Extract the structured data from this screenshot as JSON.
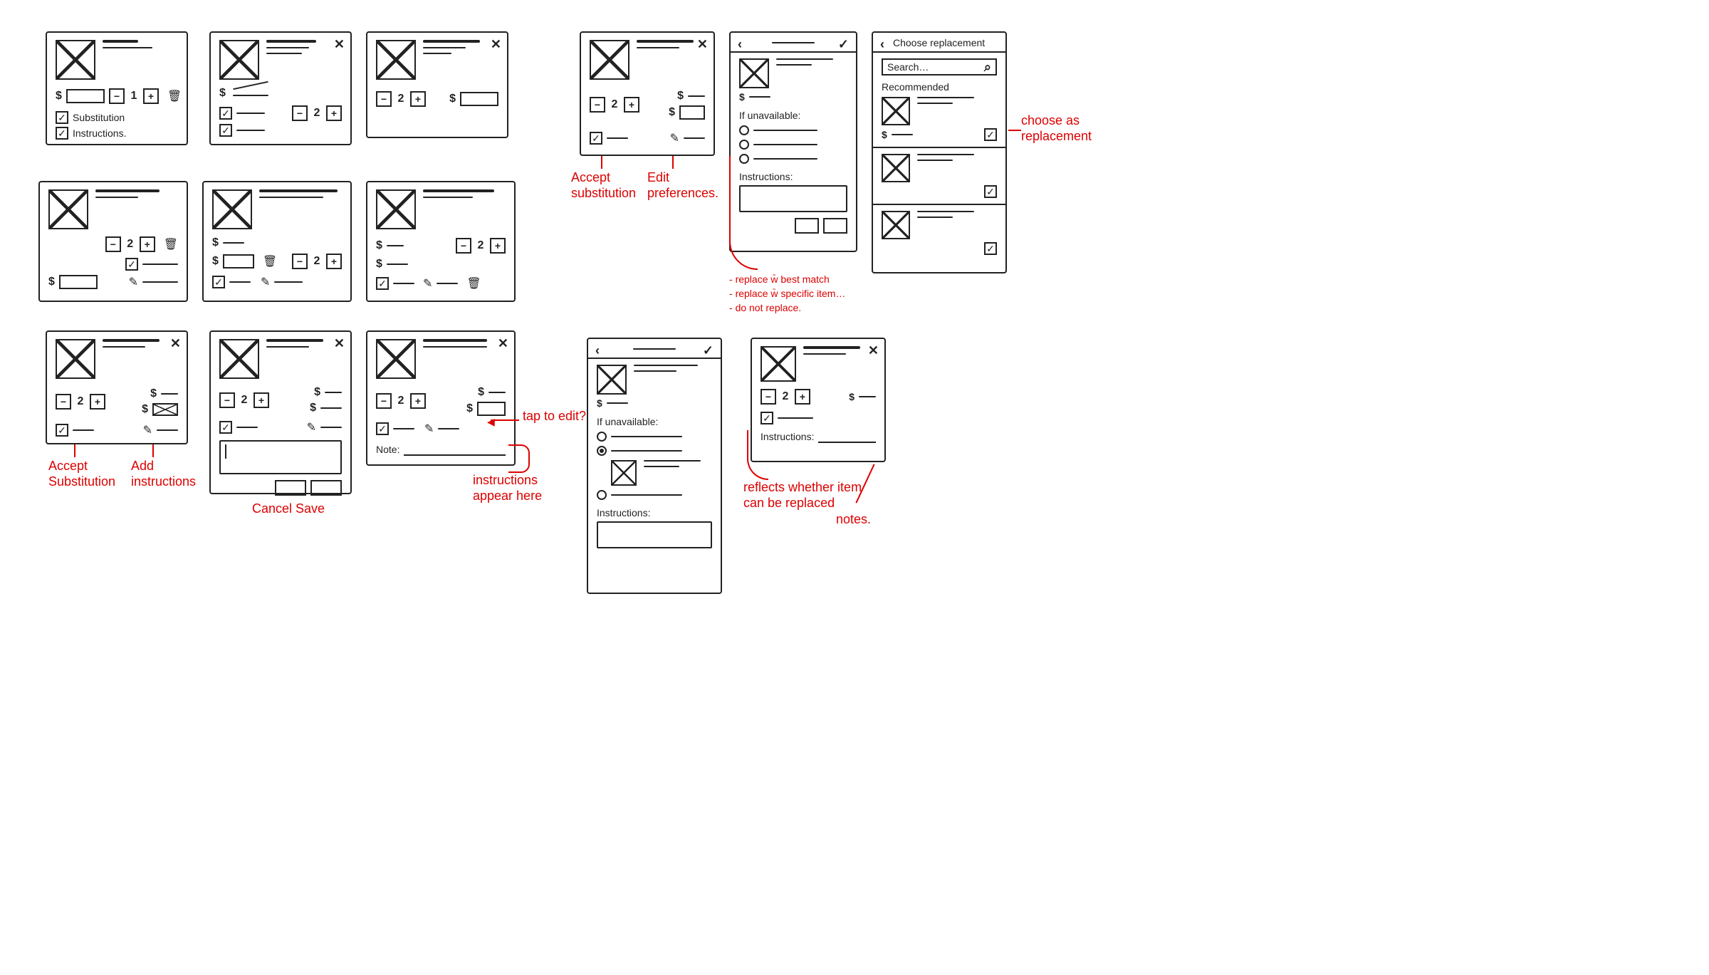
{
  "cards": {
    "a1": {
      "qty": "1",
      "row1": "Substitution",
      "row2": "Instructions."
    },
    "a2": {
      "qty": "2"
    },
    "a3": {
      "qty": "2"
    },
    "b1": {
      "qty": "2"
    },
    "b2": {
      "qty": "2"
    },
    "b3": {
      "qty": "2"
    },
    "c1": {
      "qty": "2"
    },
    "c2": {
      "qty": "2"
    },
    "c3": {
      "qty": "2",
      "note_label": "Note:"
    },
    "r1": {
      "qty": "2"
    },
    "r2": {
      "heading": "If unavailable:",
      "instr": "Instructions:"
    },
    "r3": {
      "title": "Choose replacement",
      "search": "Search…",
      "rec": "Recommended"
    },
    "r4": {
      "heading": "If unavailable:",
      "instr": "Instructions:"
    },
    "r5": {
      "qty": "2",
      "instr": "Instructions:"
    }
  },
  "ann": {
    "a_r1_left": "Accept substitution",
    "a_r1_right": "Edit preferences.",
    "a_r2_1": "replace w̄ best match",
    "a_r2_2": "replace w̄ specific item…",
    "a_r2_3": "do not replace.",
    "a_r3": "choose as replacement",
    "a_c1_left": "Accept Substitution",
    "a_c1_right": "Add instructions",
    "a_c2": "Cancel Save",
    "a_c3_top": "tap to edit?",
    "a_c3_bot": "instructions appear here",
    "a_r5_mid": "reflects whether item can be replaced",
    "a_r5_right": "notes."
  }
}
